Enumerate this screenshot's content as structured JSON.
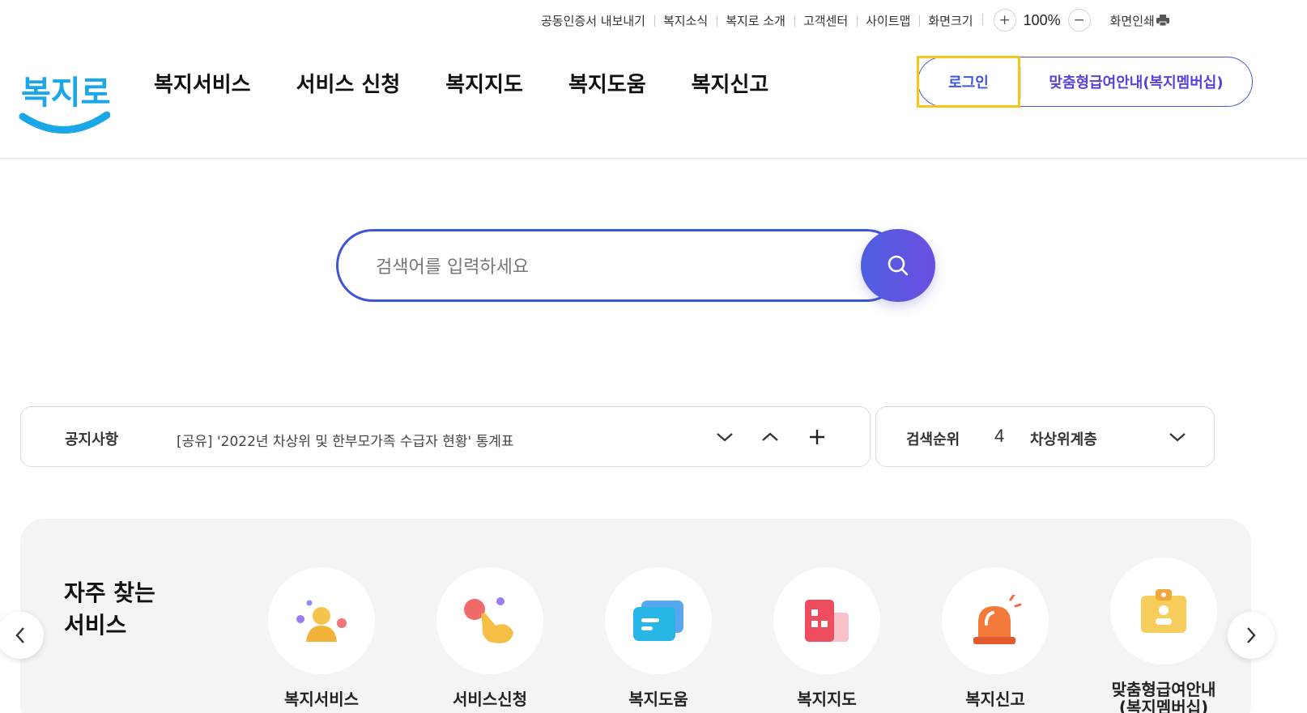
{
  "util": {
    "links": [
      "공동인증서 내보내기",
      "복지소식",
      "복지로 소개",
      "고객센터",
      "사이트맵",
      "화면크기"
    ],
    "zoom_in": "+",
    "zoom_value": "100%",
    "zoom_out": "−",
    "print_label": "화면인쇄"
  },
  "header": {
    "logo_text": "복지로",
    "gnb": [
      "복지서비스",
      "서비스 신청",
      "복지지도",
      "복지도움",
      "복지신고"
    ],
    "login_label": "로그인",
    "custom_label": "맞춤형급여안내(복지멤버십)"
  },
  "search": {
    "placeholder": "검색어를 입력하세요"
  },
  "notice": {
    "label": "공지사항",
    "text": "[공유] '2022년 차상위 및 한부모가족 수급자 현황' 통계표"
  },
  "ranking": {
    "label": "검색순위",
    "rank": "4",
    "term": "차상위계층"
  },
  "frequent": {
    "title_line1": "자주 찾는",
    "title_line2": "서비스",
    "items": [
      {
        "label": "복지서비스",
        "icon": "people-icon"
      },
      {
        "label": "서비스신청",
        "icon": "hand-tap-icon"
      },
      {
        "label": "복지도움",
        "icon": "message-icon"
      },
      {
        "label": "복지지도",
        "icon": "building-icon"
      },
      {
        "label": "복지신고",
        "icon": "alarm-siren-icon"
      },
      {
        "label_line1": "맞춤형급여안내",
        "label_line2": "(복지멤버십)",
        "icon": "member-card-icon"
      }
    ]
  },
  "colors": {
    "primary_blue": "#3e55d6",
    "accent_purple": "#5a40d8",
    "focus_yellow": "#f5c518",
    "logo_blue": "#1aa7e8"
  }
}
